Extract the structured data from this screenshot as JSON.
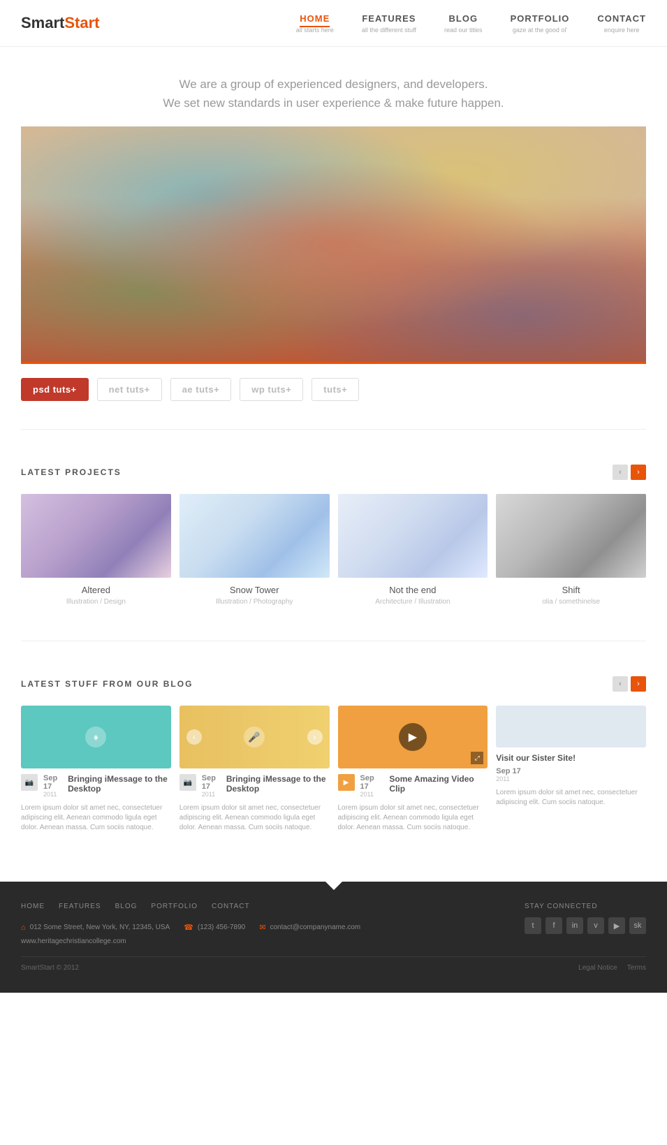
{
  "header": {
    "logo_smart": "Smart",
    "logo_start": "Start",
    "nav": [
      {
        "label": "HOME",
        "sub": "all starts here",
        "active": true
      },
      {
        "label": "FEATURES",
        "sub": "all the different stuff",
        "active": false
      },
      {
        "label": "BLOG",
        "sub": "read our titles",
        "active": false
      },
      {
        "label": "PORTFOLIO",
        "sub": "gaze at the good ol'",
        "active": false
      },
      {
        "label": "CONTACT",
        "sub": "enquire here",
        "active": false
      }
    ]
  },
  "hero": {
    "line1": "We are a group of experienced designers, and developers.",
    "line2": "We set new standards in user experience & make future happen."
  },
  "brands": [
    {
      "label": "psd tuts+",
      "active": true
    },
    {
      "label": "net tuts+",
      "active": false
    },
    {
      "label": "ae tuts+",
      "active": false
    },
    {
      "label": "wp tuts+",
      "active": false
    },
    {
      "label": "tuts+",
      "active": false
    }
  ],
  "projects": {
    "section_title": "LATEST PROJECTS",
    "items": [
      {
        "name": "Altered",
        "sub": "Illustration / Design"
      },
      {
        "name": "Snow Tower",
        "sub": "Illustration / Photography"
      },
      {
        "name": "Not the end",
        "sub": "Architecture / Illustration"
      },
      {
        "name": "Shift",
        "sub": "olia / somethinelse"
      }
    ]
  },
  "blog": {
    "section_title": "LATEST STUFF FROM OUR BLOG",
    "items": [
      {
        "title": "Bringing iMessage to the Desktop",
        "date_num": "Sep 17",
        "date_year": "2011",
        "text": "Lorem ipsum dolor sit amet nec, consectetuer adipiscing elit. Aenean commodo ligula eget dolor. Aenean massa. Cum sociis natoque."
      },
      {
        "title": "Bringing iMessage to the Desktop",
        "date_num": "Sep 17",
        "date_year": "2011",
        "text": "Lorem ipsum dolor sit amet nec, consectetuer adipiscing elit. Aenean commodo ligula eget dolor. Aenean massa. Cum sociis natoque."
      },
      {
        "title": "Some Amazing Video Clip",
        "date_num": "Sep 17",
        "date_year": "2011",
        "text": "Lorem ipsum dolor sit amet nec, consectetuer adipiscing elit. Aenean commodo ligula eget dolor. Aenean massa. Cum sociis natoque."
      },
      {
        "sister_title": "Visit our Sister Site!",
        "date_num": "Sep 17",
        "date_year": "2011",
        "text": "Lorem ipsum dolor sit amet nec, consectetuer adipiscing elit. Cum sociis natoque."
      }
    ]
  },
  "footer": {
    "nav": [
      "HOME",
      "FEATURES",
      "BLOG",
      "PORTFOLIO",
      "CONTACT"
    ],
    "stay_connected": "STAY CONNECTED",
    "address": "012 Some Street, New York, NY, 12345, USA",
    "phone": "(123) 456-7890",
    "email": "contact@companyname.com",
    "url": "www.heritagechristiancollege.com",
    "copyright": "SmartStart © 2012",
    "legal": "Legal Notice",
    "terms": "Terms",
    "social": [
      "t",
      "f",
      "in",
      "v",
      "yt",
      "sk"
    ]
  }
}
